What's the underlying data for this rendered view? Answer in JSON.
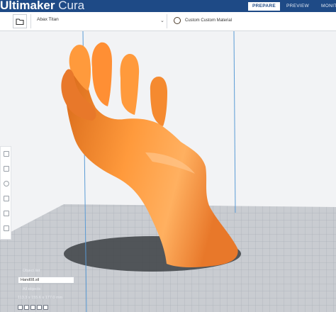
{
  "app": {
    "title_bold": "Ultimaker",
    "title_light": "Cura"
  },
  "stages": [
    {
      "label": "PREPARE",
      "active": true
    },
    {
      "label": "PREVIEW",
      "active": false
    },
    {
      "label": "MONITOR",
      "active": false
    }
  ],
  "config": {
    "printer": "Abax Titan",
    "material": "Custom Custom Material"
  },
  "object": {
    "section_label": "Object list",
    "file_name": "Hand08.stl",
    "group_label": "All objects",
    "dimensions": "113.3 x 155.6 x 177.0 mm"
  },
  "icons": {
    "open": "folder-icon",
    "dropdown": "chevron-down-icon",
    "material": "material-spool-icon",
    "tools": [
      "move-icon",
      "scale-icon",
      "rotate-icon",
      "mirror-icon",
      "per-model-settings-icon",
      "support-blocker-icon"
    ]
  },
  "colors": {
    "brand": "#1e4a86",
    "model": "#ff8c2e",
    "build_plate": "#b9bcc2"
  }
}
